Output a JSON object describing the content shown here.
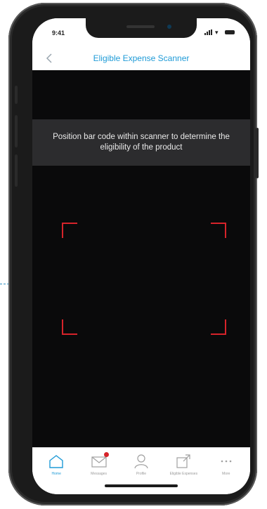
{
  "status_bar": {
    "time": "9:41"
  },
  "header": {
    "title": "Eligible Expense Scanner",
    "back_icon": "chevron-left-icon"
  },
  "scanner": {
    "instruction": "Position bar code within scanner to determine the eligibility of the product",
    "frame_color": "#d6232a"
  },
  "tabs": [
    {
      "label": "Home",
      "icon": "home-icon",
      "active": true
    },
    {
      "label": "Messages",
      "icon": "envelope-icon",
      "badge": true
    },
    {
      "label": "Profile",
      "icon": "person-icon"
    },
    {
      "label": "Eligible Expenses",
      "icon": "external-link-icon"
    },
    {
      "label": "More",
      "icon": "more-dots-icon"
    }
  ],
  "colors": {
    "accent": "#1f9bd7",
    "camera_bg": "#0a0a0b",
    "banner_bg": "#2c2c2e"
  }
}
